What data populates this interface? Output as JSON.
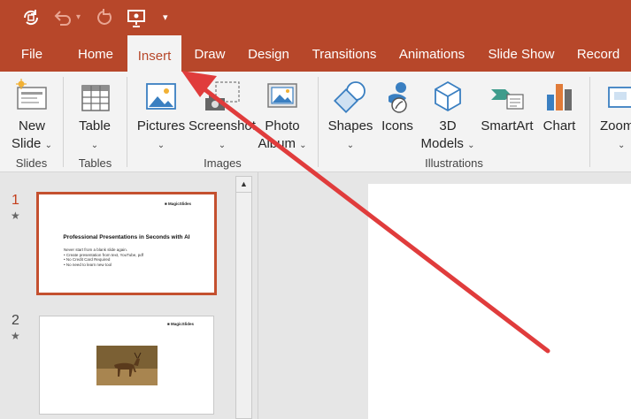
{
  "colors": {
    "accent": "#b7472a",
    "ribbon_bg": "#f3f3f3",
    "arrow": "#e03c3c"
  },
  "qat": {
    "icons": [
      "autosave-icon",
      "undo-icon",
      "redo-icon",
      "present-icon",
      "customize-icon"
    ]
  },
  "tabs": [
    "File",
    "Home",
    "Insert",
    "Draw",
    "Design",
    "Transitions",
    "Animations",
    "Slide Show",
    "Record"
  ],
  "active_tab": "Insert",
  "ribbon": {
    "new_slide": {
      "line1": "New",
      "line2": "Slide"
    },
    "table": "Table",
    "pictures": "Pictures",
    "screenshot": "Screenshot",
    "photo_album": {
      "line1": "Photo",
      "line2": "Album"
    },
    "shapes": "Shapes",
    "icons": "Icons",
    "models": {
      "line1": "3D",
      "line2": "Models"
    },
    "smartart": "SmartArt",
    "chart": "Chart",
    "zoom": "Zoom",
    "groups": {
      "slides": "Slides",
      "tables": "Tables",
      "images": "Images",
      "illustrations": "Illustrations"
    }
  },
  "slides": [
    {
      "number": "1",
      "brand": "MagicSlides",
      "title": "Professional Presentations in Seconds with AI",
      "lines": [
        "Never start from a blank slide again.",
        "• Create presentation from text, YouTube, pdf",
        "• No Credit Card Required",
        "• No need to learn new tool"
      ]
    },
    {
      "number": "2",
      "brand": "MagicSlides"
    }
  ]
}
